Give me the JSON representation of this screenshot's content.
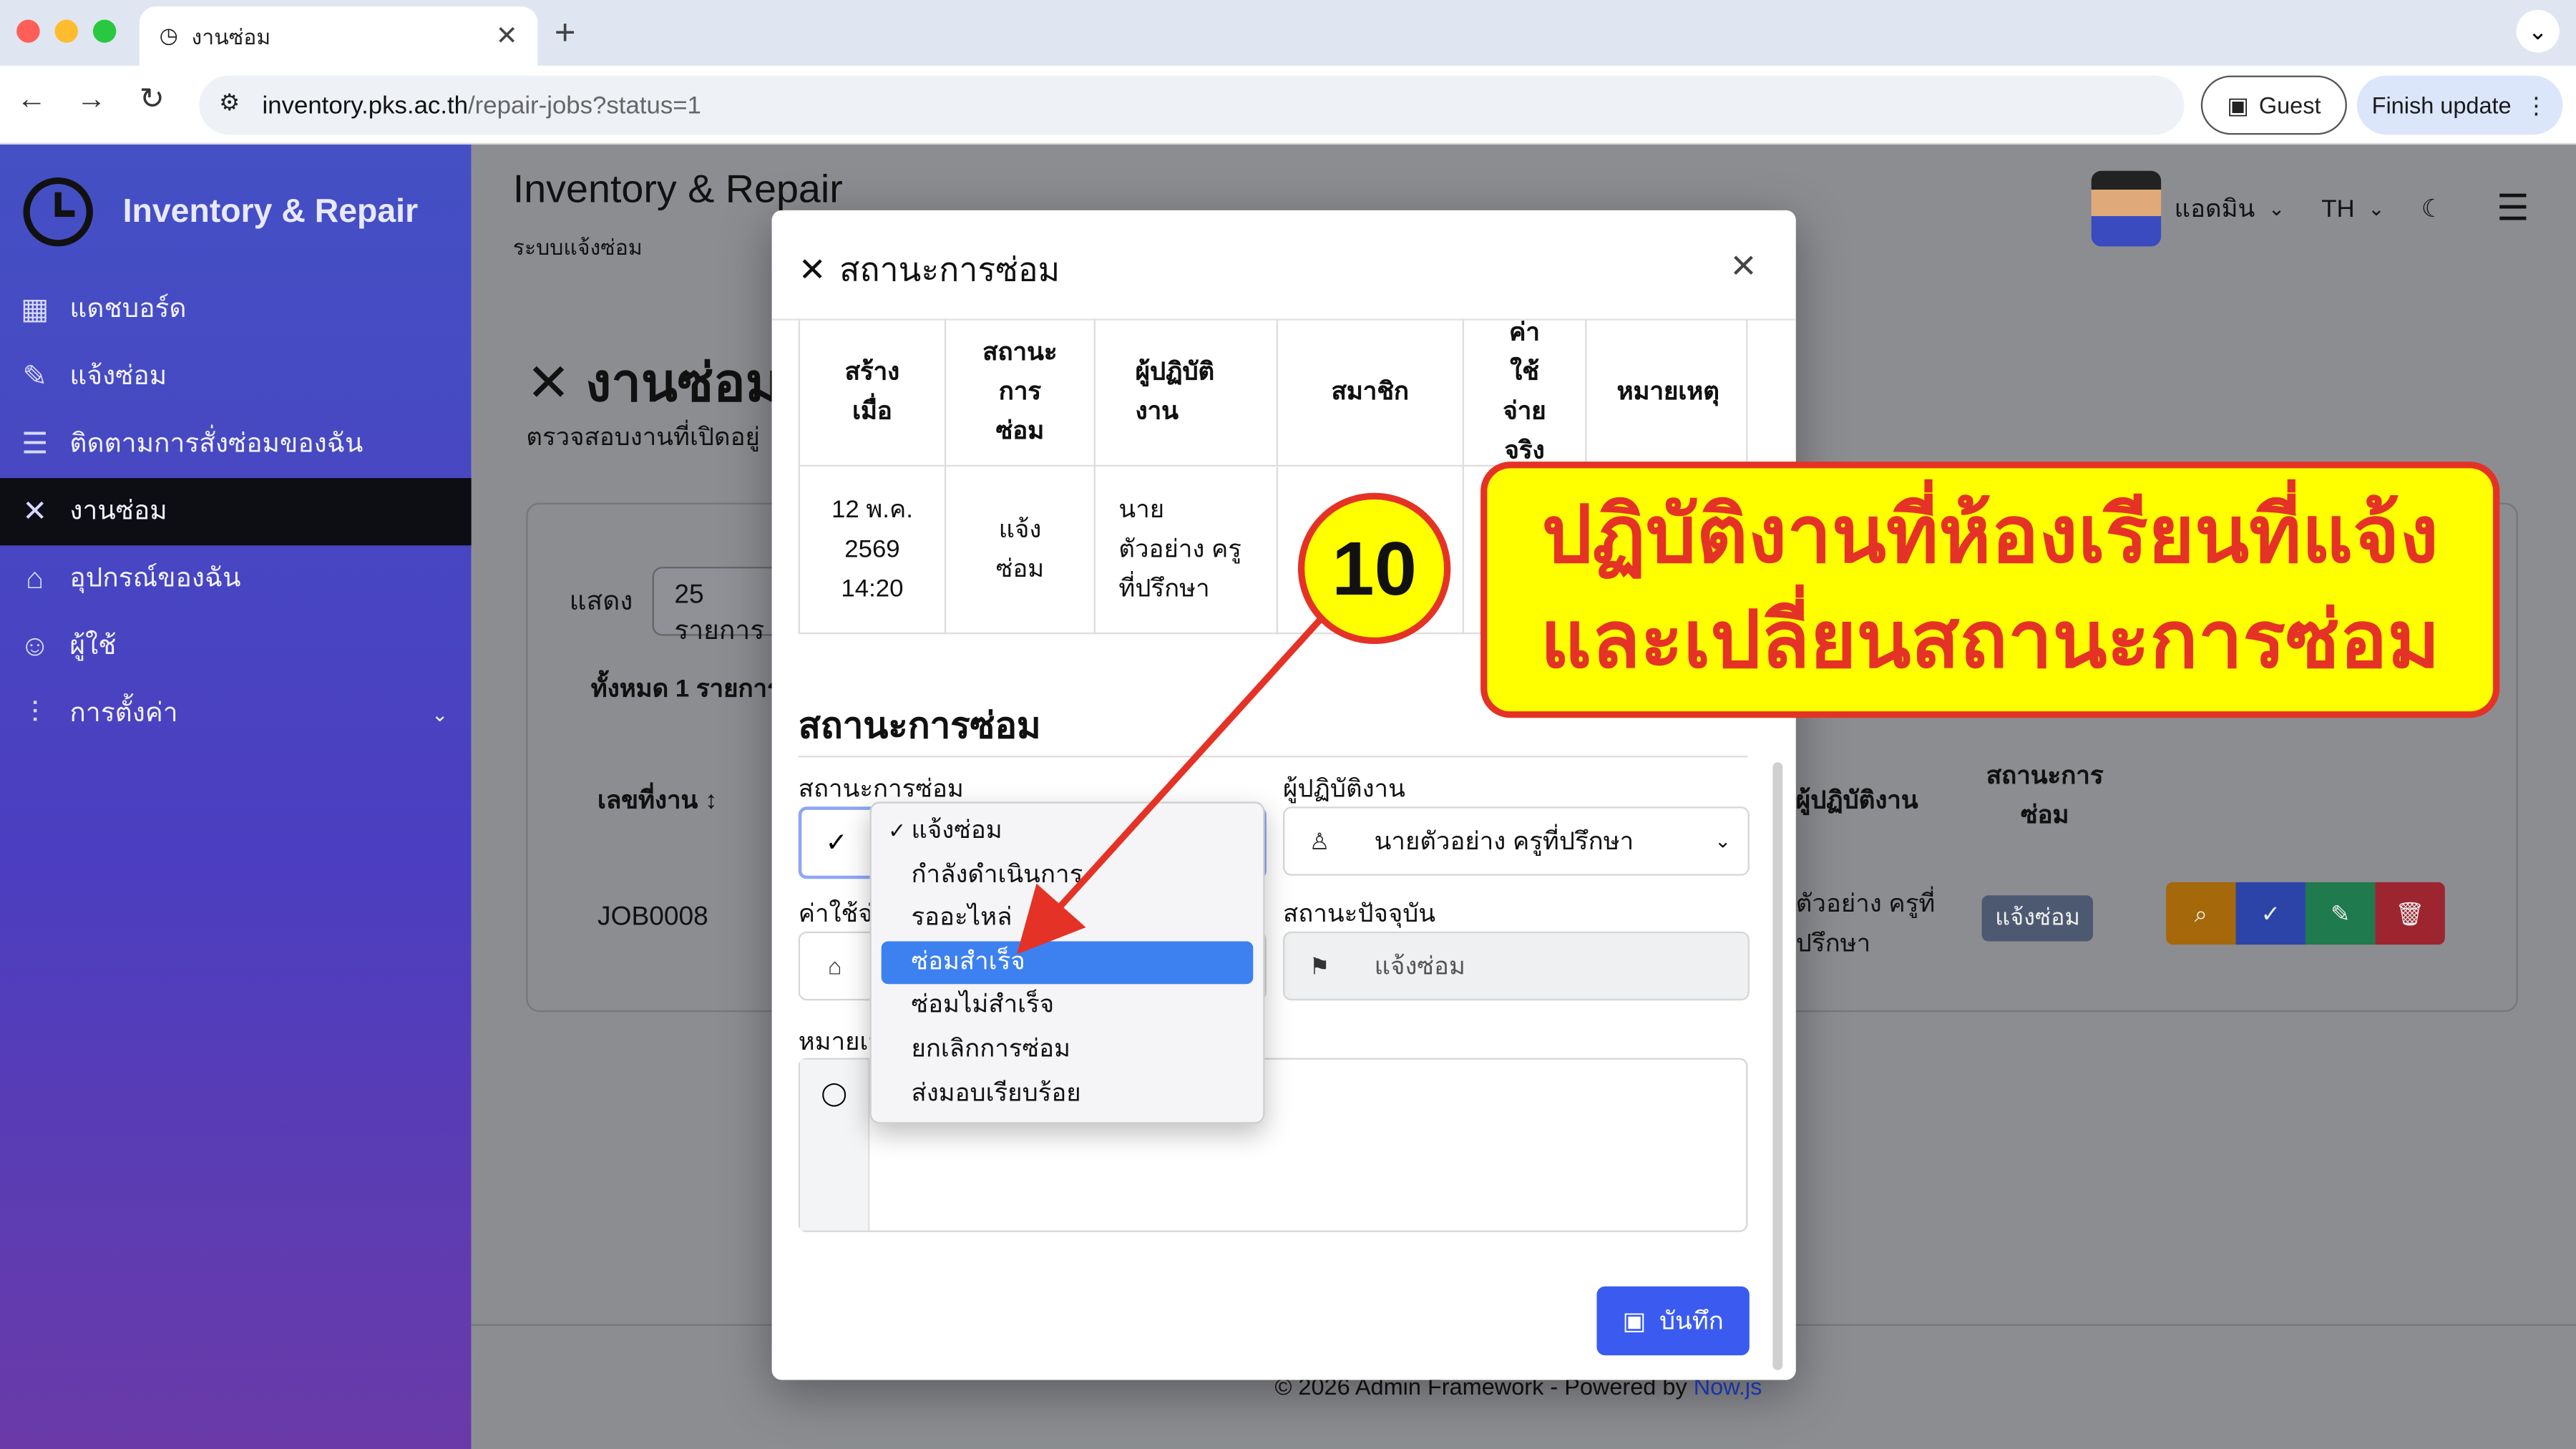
{
  "browser": {
    "tab_title": "งานซ่อม",
    "url_host": "inventory.pks.ac.th",
    "url_path": "/repair-jobs?status=1",
    "guest_label": "Guest",
    "finish_update_label": "Finish update"
  },
  "sidebar": {
    "brand": "Inventory & Repair",
    "items": [
      {
        "label": "แดชบอร์ด",
        "icon": "dashboard-icon"
      },
      {
        "label": "แจ้งซ่อม",
        "icon": "report-repair-icon"
      },
      {
        "label": "ติดตามการสั่งซ่อมของฉัน",
        "icon": "checklist-icon"
      },
      {
        "label": "งานซ่อม",
        "icon": "tools-icon",
        "active": true
      },
      {
        "label": "อุปกรณ์ของฉัน",
        "icon": "store-icon"
      },
      {
        "label": "ผู้ใช้",
        "icon": "users-icon"
      },
      {
        "label": "การตั้งค่า",
        "icon": "sliders-icon"
      }
    ]
  },
  "header": {
    "title": "Inventory & Repair",
    "subtitle": "ระบบแจ้งซ่อม",
    "user_name": "แอดมิน",
    "language": "TH"
  },
  "page": {
    "heading": "งานซ่อม",
    "description": "ตรวจสอบงานที่เปิดอยู่",
    "show_label": "แสดง",
    "page_size": "25 รายการ",
    "total": "ทั้งหมด 1 รายการ",
    "col_job_no": "เลขที่งาน",
    "col_technician": "ผู้ปฏิบัติงาน",
    "col_status": "สถานะการซ่อม",
    "row_job_no": "JOB0008",
    "row_technician": "ตัวอย่าง ครูที่ปรึกษา",
    "row_status": "แจ้งซ่อม"
  },
  "footer": {
    "copyright": "© 2026 Admin Framework - Powered by ",
    "powered_link": "Now.js"
  },
  "modal": {
    "title": "สถานะการซ่อม",
    "history_headers": [
      "สร้างเมื่อ",
      "สถานะการซ่อม",
      "ผู้ปฏิบัติงาน",
      "สมาชิก",
      "ค่าใช้จ่ายจริง",
      "หมายเหตุ"
    ],
    "history_row": {
      "created": "12 พ.ค. 2569 14:20",
      "status": "แจ้งซ่อม",
      "technician": "นาย ตัวอย่าง ครูที่ปรึกษา",
      "member": "น",
      "cost": "",
      "note": ""
    },
    "section_title": "สถานะการซ่อม",
    "status_label": "สถานะการซ่อม",
    "technician_label": "ผู้ปฏิบัติงาน",
    "technician_value": "นายตัวอย่าง ครูที่ปรึกษา",
    "cost_label": "ค่าใช้จ่าย",
    "current_status_label": "สถานะปัจจุบัน",
    "current_status_value": "แจ้งซ่อม",
    "notes_label": "หมายเหตุ",
    "save_label": "บันทึก"
  },
  "status_dropdown": {
    "options": [
      "แจ้งซ่อม",
      "กำลังดำเนินการ",
      "รออะไหล่",
      "ซ่อมสำเร็จ",
      "ซ่อมไม่สำเร็จ",
      "ยกเลิกการซ่อม",
      "ส่งมอบเรียบร้อย"
    ],
    "selected": "แจ้งซ่อม",
    "highlighted": "ซ่อมสำเร็จ"
  },
  "annotation": {
    "step": "10",
    "line1": "ปฏิบัติงานที่ห้องเรียนที่แจ้ง",
    "line2": "และเปลี่ยนสถานะการซ่อม"
  },
  "colors": {
    "sidebar_top": "#4450c4",
    "accent": "#3b5bf0",
    "callout_bg": "#ffff00",
    "callout_red": "#e53226"
  }
}
